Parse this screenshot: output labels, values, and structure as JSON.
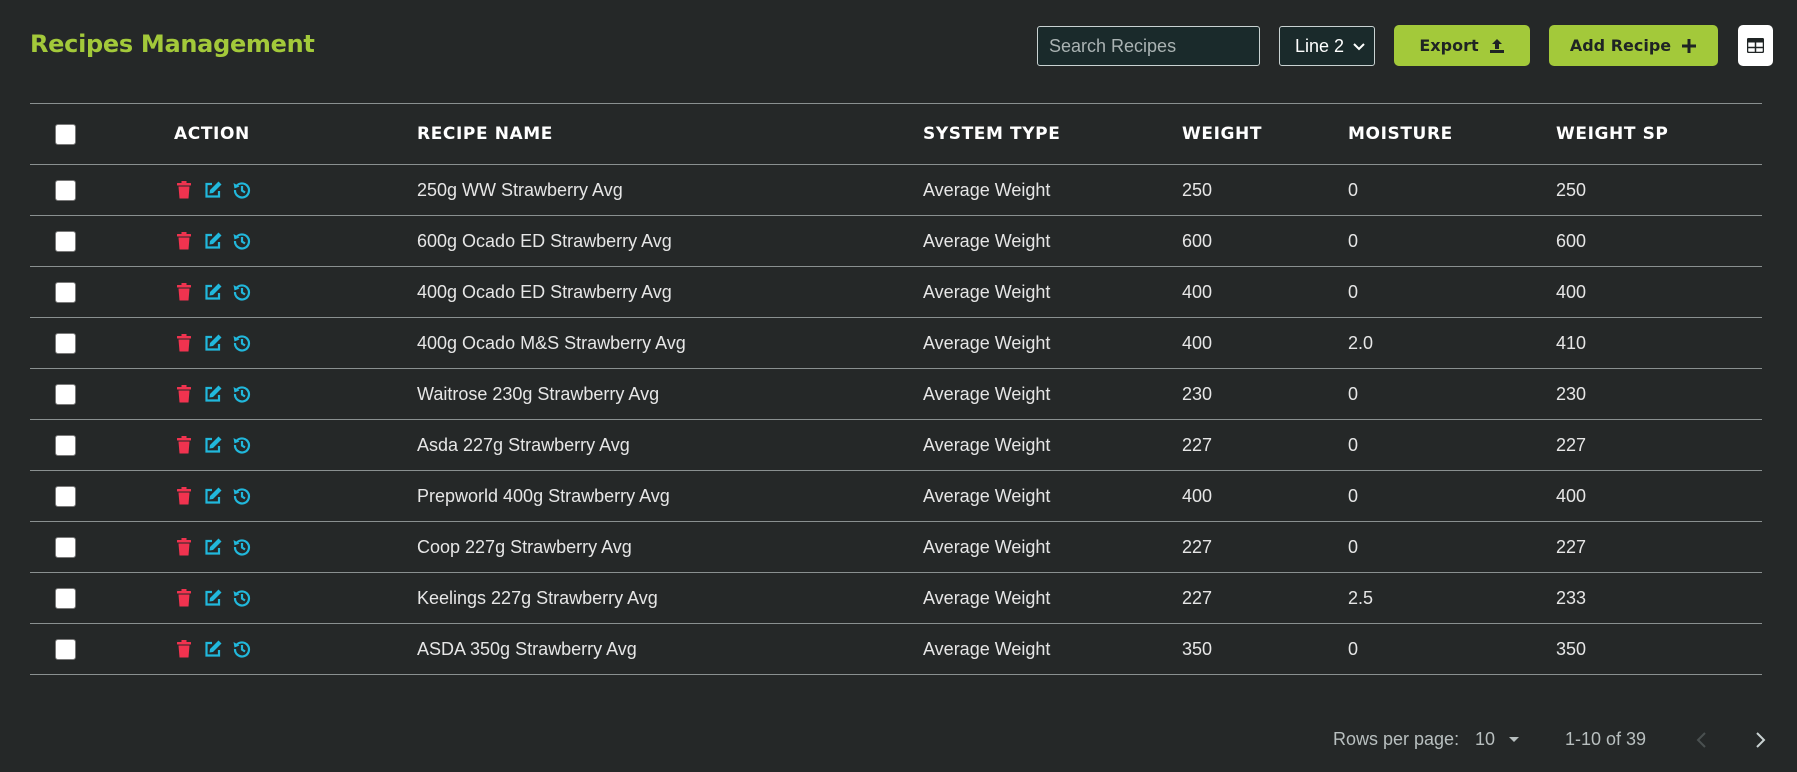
{
  "page": {
    "title": "Recipes Management"
  },
  "toolbar": {
    "search_placeholder": "Search Recipes",
    "line_select_value": "Line 2",
    "export_label": "Export",
    "add_label": "Add Recipe"
  },
  "table": {
    "headers": {
      "action": "ACTION",
      "recipe_name": "RECIPE NAME",
      "system_type": "SYSTEM TYPE",
      "weight": "WEIGHT",
      "moisture": "MOISTURE",
      "weight_sp": "WEIGHT SP"
    },
    "rows": [
      {
        "name": "250g WW Strawberry Avg",
        "type": "Average Weight",
        "weight": "250",
        "moisture": "0",
        "weight_sp": "250"
      },
      {
        "name": "600g Ocado ED Strawberry Avg",
        "type": "Average Weight",
        "weight": "600",
        "moisture": "0",
        "weight_sp": "600"
      },
      {
        "name": "400g Ocado ED Strawberry Avg",
        "type": "Average Weight",
        "weight": "400",
        "moisture": "0",
        "weight_sp": "400"
      },
      {
        "name": "400g Ocado M&S Strawberry Avg",
        "type": "Average Weight",
        "weight": "400",
        "moisture": "2.0",
        "weight_sp": "410"
      },
      {
        "name": "Waitrose 230g Strawberry Avg",
        "type": "Average Weight",
        "weight": "230",
        "moisture": "0",
        "weight_sp": "230"
      },
      {
        "name": "Asda 227g Strawberry Avg",
        "type": "Average Weight",
        "weight": "227",
        "moisture": "0",
        "weight_sp": "227"
      },
      {
        "name": "Prepworld 400g Strawberry Avg",
        "type": "Average Weight",
        "weight": "400",
        "moisture": "0",
        "weight_sp": "400"
      },
      {
        "name": "Coop 227g Strawberry Avg",
        "type": "Average Weight",
        "weight": "227",
        "moisture": "0",
        "weight_sp": "227"
      },
      {
        "name": "Keelings 227g Strawberry Avg",
        "type": "Average Weight",
        "weight": "227",
        "moisture": "2.5",
        "weight_sp": "233"
      },
      {
        "name": "ASDA 350g Strawberry Avg",
        "type": "Average Weight",
        "weight": "350",
        "moisture": "0",
        "weight_sp": "350"
      }
    ]
  },
  "pagination": {
    "rows_per_page_label": "Rows per page:",
    "rows_per_page_value": "10",
    "range_label": "1-10 of 39"
  },
  "icons": {
    "delete": "trash-icon",
    "edit": "edit-icon",
    "history": "history-icon",
    "export": "upload-icon",
    "add": "plus-icon",
    "view_toggle": "table-view-icon"
  },
  "colors": {
    "accent": "#a3c93a",
    "delete": "#f0334f",
    "edit": "#21b8dc",
    "background": "#252828"
  }
}
